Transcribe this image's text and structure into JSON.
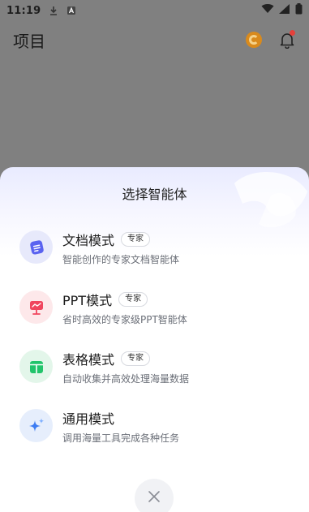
{
  "status_bar": {
    "time": "11:19",
    "left_icons": [
      "download-icon",
      "a-badge-icon"
    ],
    "right_icons": [
      "wifi-icon",
      "signal-icon",
      "battery-icon"
    ]
  },
  "app_bar": {
    "title": "项目",
    "actions": [
      "coin-icon",
      "bell-icon"
    ]
  },
  "sheet": {
    "title": "选择智能体",
    "modes": [
      {
        "name": "文档模式",
        "badge": "专家",
        "desc": "智能创作的专家文档智能体",
        "icon": "document-icon",
        "accent": "#5a63f0"
      },
      {
        "name": "PPT模式",
        "badge": "专家",
        "desc": "省时高效的专家级PPT智能体",
        "icon": "presentation-icon",
        "accent": "#f0455e"
      },
      {
        "name": "表格模式",
        "badge": "专家",
        "desc": "自动收集并高效处理海量数据",
        "icon": "table-icon",
        "accent": "#22c46b"
      },
      {
        "name": "通用模式",
        "badge": "",
        "desc": "调用海量工具完成各种任务",
        "icon": "sparkle-icon",
        "accent": "#3d7cf2"
      }
    ],
    "close_icon": "close-icon"
  },
  "colors": {
    "scrim": "#808080",
    "sheet_top": "#e9ebff",
    "sheet_bottom": "#ffffff"
  }
}
